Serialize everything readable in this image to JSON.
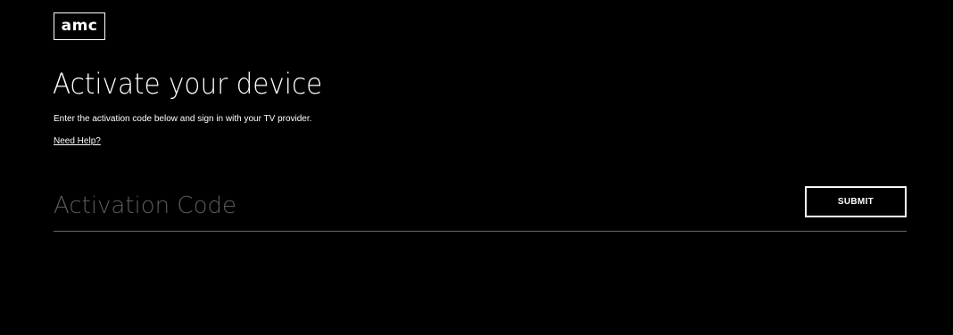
{
  "header": {
    "logo_text": "amc"
  },
  "main": {
    "title": "Activate your device",
    "subtitle": "Enter the activation code below and sign in with your TV provider.",
    "help_link": "Need Help?"
  },
  "form": {
    "code_placeholder": "Activation Code",
    "code_value": "",
    "submit_label": "SUBMIT"
  },
  "colors": {
    "background": "#000000",
    "text": "#ffffff",
    "placeholder": "#5c5c5c",
    "divider": "#6b6b6b"
  }
}
